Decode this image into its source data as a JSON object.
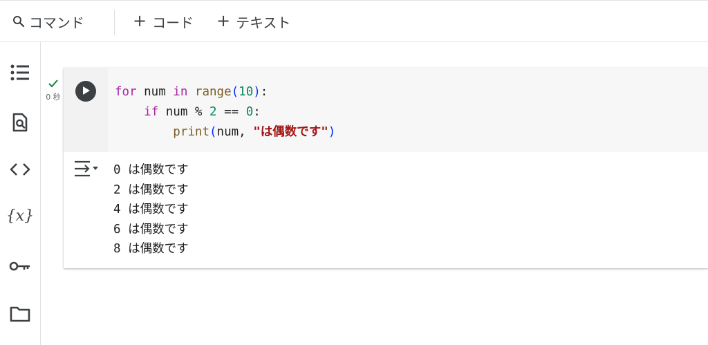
{
  "toolbar": {
    "command_icon": "search-icon",
    "command_label": "コマンド",
    "add_code_label": "コード",
    "add_text_label": "テキスト",
    "plus_symbol": "+"
  },
  "sidebar": {
    "items": [
      {
        "name": "table-of-contents",
        "icon": "list-icon"
      },
      {
        "name": "find-replace",
        "icon": "document-search-icon"
      },
      {
        "name": "code-snippets",
        "icon": "code-brackets-icon"
      },
      {
        "name": "variables",
        "icon": "variables-icon",
        "label": "{x}"
      },
      {
        "name": "secrets",
        "icon": "key-icon"
      },
      {
        "name": "files",
        "icon": "folder-icon"
      }
    ]
  },
  "cell": {
    "status_icon": "check-icon",
    "exec_time": "0 秒",
    "code": {
      "line1": {
        "kw_for": "for",
        "var": " num ",
        "kw_in": "in",
        "space": " ",
        "fn": "range",
        "open": "(",
        "num": "10",
        "close": ")",
        "colon": ":"
      },
      "line2": {
        "indent": "    ",
        "kw_if": "if",
        "rest1": " num % ",
        "num2": "2",
        "rest2": " == ",
        "num0": "0",
        "colon": ":"
      },
      "line3": {
        "indent": "        ",
        "fn": "print",
        "open": "(",
        "args": "num, ",
        "str": "\"は偶数です\"",
        "close": ")"
      }
    },
    "output": [
      "0 は偶数です",
      "2 は偶数です",
      "4 は偶数です",
      "6 は偶数です",
      "8 は偶数です"
    ]
  },
  "colors": {
    "keyword": "#a626a4",
    "function": "#795e26",
    "number": "#098658",
    "string": "#a31515",
    "success": "#188038"
  }
}
